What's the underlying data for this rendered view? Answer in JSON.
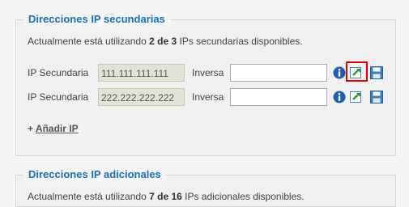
{
  "secondary": {
    "title": "Direcciones IP secundarias",
    "usage": {
      "prefix": "Actualmente está utilizando",
      "bold": "2 de 3",
      "suffix": "IPs secundarias disponibles."
    },
    "rows": [
      {
        "label": "IP Secundaria",
        "ip": "111.111.111.111",
        "inverse_label": "Inversa",
        "inverse_value": ""
      },
      {
        "label": "IP Secundaria",
        "ip": "222.222.222.222",
        "inverse_label": "Inversa",
        "inverse_value": ""
      }
    ],
    "add_plus": "+",
    "add_label": "Añadir IP"
  },
  "additional": {
    "title": "Direcciones IP adicionales",
    "usage": {
      "prefix": "Actualmente está utilizando",
      "bold": "7 de 16",
      "suffix": "IPs adicionales disponibles."
    }
  },
  "icons": [
    "info-icon",
    "edit-icon",
    "save-icon"
  ],
  "colors": {
    "accent": "#1a6fbd",
    "highlight": "#e00000"
  }
}
